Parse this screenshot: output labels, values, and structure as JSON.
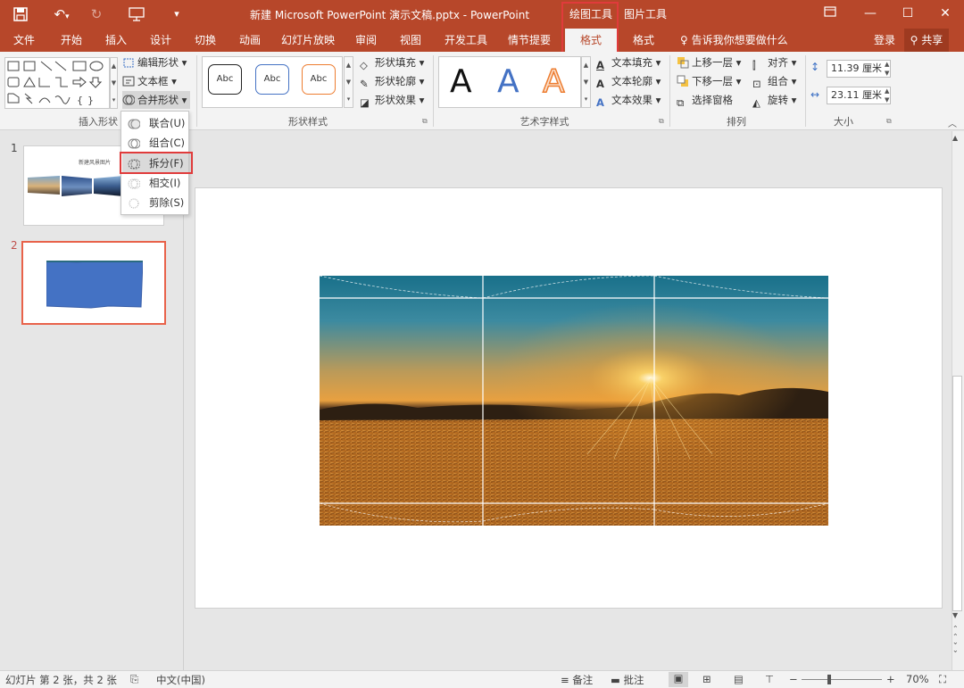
{
  "titlebar": {
    "title": "新建 Microsoft PowerPoint 演示文稿.pptx - PowerPoint",
    "ctx_drawing": "绘图工具",
    "ctx_picture": "图片工具",
    "bg_color": "#b7472a"
  },
  "tabs": [
    "文件",
    "开始",
    "插入",
    "设计",
    "切换",
    "动画",
    "幻灯片放映",
    "审阅",
    "视图",
    "开发工具",
    "情节提要",
    "格式",
    "格式"
  ],
  "tell_me": "告诉我你想要做什么",
  "login": "登录",
  "share": "共享",
  "ribbon": {
    "insert_shapes": {
      "edit_shape": "编辑形状",
      "text_box": "文本框",
      "merge_shapes": "合并形状",
      "label": "插入形状"
    },
    "shape_styles": {
      "swatch": "Abc",
      "fill": "形状填充",
      "outline": "形状轮廓",
      "effects": "形状效果",
      "label": "形状样式"
    },
    "wordart": {
      "letter": "A",
      "text_fill": "文本填充",
      "text_outline": "文本轮廓",
      "text_effects": "文本效果",
      "label": "艺术字样式"
    },
    "arrange": {
      "bring_forward": "上移一层",
      "send_backward": "下移一层",
      "selection_pane": "选择窗格",
      "align": "对齐",
      "group": "组合",
      "rotate": "旋转",
      "label": "排列"
    },
    "size": {
      "height": "11.39 厘米",
      "width": "23.11 厘米",
      "label": "大小"
    }
  },
  "merge_menu": [
    "联合(U)",
    "组合(C)",
    "拆分(F)",
    "相交(I)",
    "剪除(S)"
  ],
  "thumbnails": [
    {
      "num": "1",
      "title": "新建风景图片"
    },
    {
      "num": "2",
      "title": ""
    }
  ],
  "status": {
    "slide_info": "幻灯片 第 2 张，共 2 张",
    "language": "中文(中国)",
    "notes": "备注",
    "comments": "批注",
    "zoom": "70%"
  },
  "accent_red": "#e03b3b"
}
